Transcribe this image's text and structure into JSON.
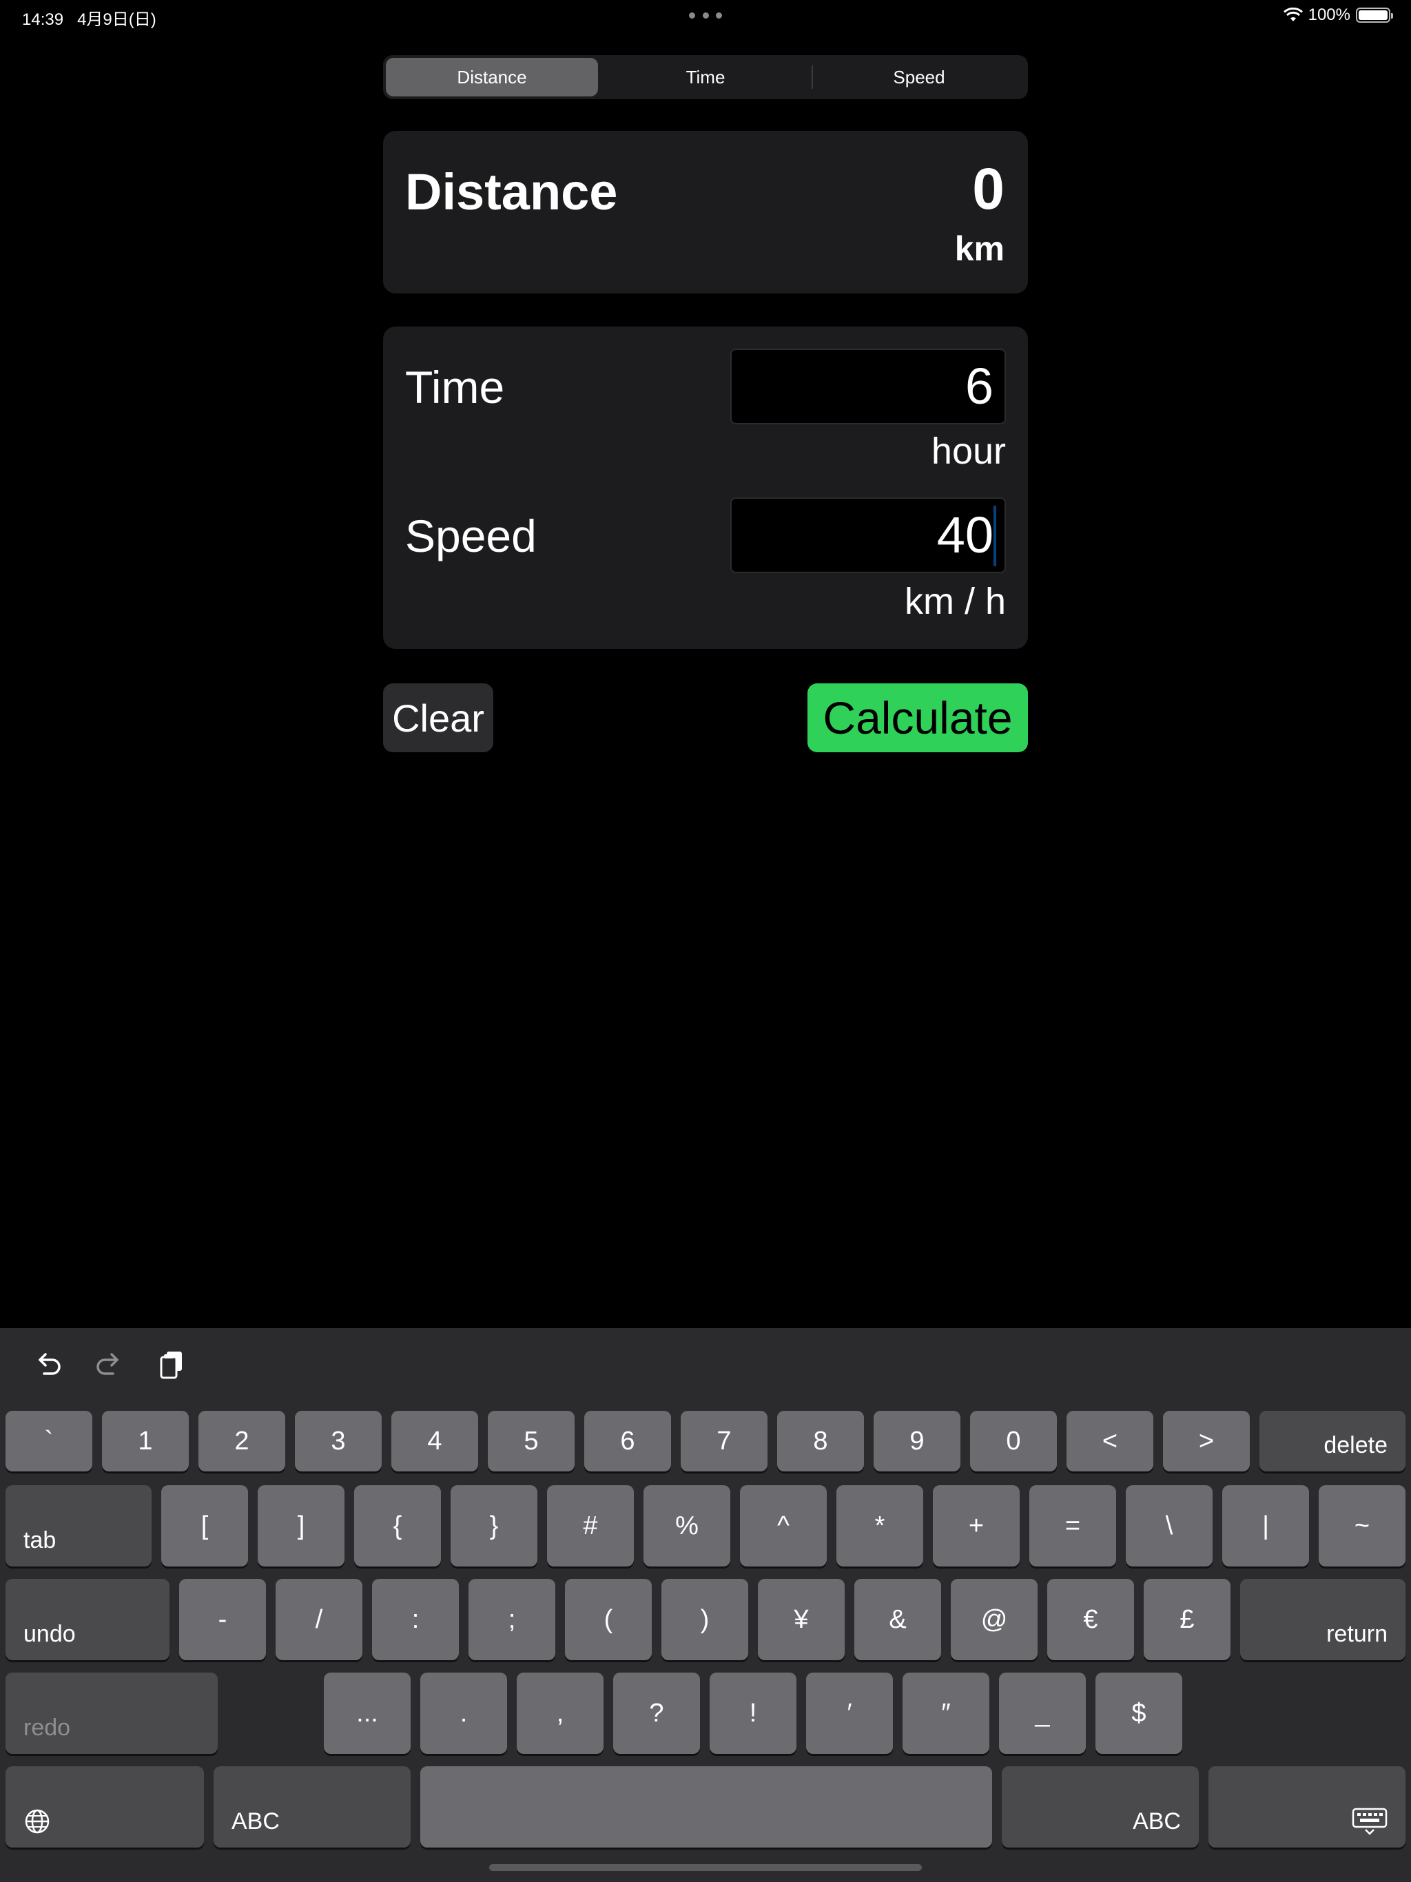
{
  "status": {
    "time": "14:39",
    "date": "4月9日(日)",
    "battery": "100%",
    "battery_level": 1.0
  },
  "segment": {
    "tabs": [
      "Distance",
      "Time",
      "Speed"
    ],
    "selected": "Distance"
  },
  "result": {
    "title": "Distance",
    "value": "0",
    "unit": "km"
  },
  "inputs": {
    "time": {
      "label": "Time",
      "value": "6",
      "unit": "hour"
    },
    "speed": {
      "label": "Speed",
      "value": "40",
      "unit": "km / h"
    }
  },
  "buttons": {
    "clear": "Clear",
    "calculate": "Calculate"
  },
  "colors": {
    "background": "#000000",
    "card": "#1c1c1e",
    "segment_active": "#636366",
    "calculate": "#30d158",
    "caret": "#0a84ff"
  },
  "keyboard": {
    "row1": [
      "`",
      "1",
      "2",
      "3",
      "4",
      "5",
      "6",
      "7",
      "8",
      "9",
      "0",
      "<",
      ">"
    ],
    "row1_end": "delete",
    "row2_start": "tab",
    "row2": [
      "[",
      "]",
      "{",
      "}",
      "#",
      "%",
      "^",
      "*",
      "+",
      "=",
      "\\",
      "|",
      "~"
    ],
    "row3_start": "undo",
    "row3": [
      "-",
      "/",
      ":",
      ";",
      "(",
      ")",
      "¥",
      "&",
      "@",
      "€",
      "£"
    ],
    "row3_end": "return",
    "row4_start": "redo",
    "row4": [
      "...",
      ".",
      ",",
      "?",
      "!",
      "′",
      "″",
      "_",
      "$"
    ],
    "row5_abc": "ABC",
    "row5_abc_right": "ABC",
    "icons": [
      "undo-icon",
      "redo-icon",
      "paste-icon",
      "globe-icon",
      "keyboard-dismiss-icon"
    ]
  }
}
